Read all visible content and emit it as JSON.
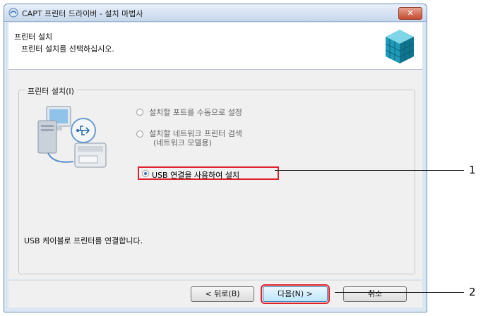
{
  "window": {
    "title": "CAPT 프린터 드라이버 - 설치 마법사",
    "close_label": "✕"
  },
  "header": {
    "title": "프린터 설치",
    "subtitle": "프린터 설치를 선택하십시오."
  },
  "group": {
    "label": "프린터 설치(I)",
    "options": [
      {
        "label": "설치할 포트를 수동으로 설정",
        "selected": false
      },
      {
        "label": "설치할 네트워크 프린터 검색",
        "label2": "(네트워크 모델용)",
        "selected": false
      },
      {
        "label": "USB 연결을 사용하여 설치",
        "selected": true
      }
    ],
    "description": "USB 케이블로 프린터를 연결합니다."
  },
  "buttons": {
    "back": "< 뒤로(B)",
    "next": "다음(N) >",
    "cancel": "취소"
  },
  "callouts": [
    "1",
    "2"
  ],
  "colors": {
    "highlight": "#e0212b",
    "title_bar": "#c6d7ec"
  }
}
